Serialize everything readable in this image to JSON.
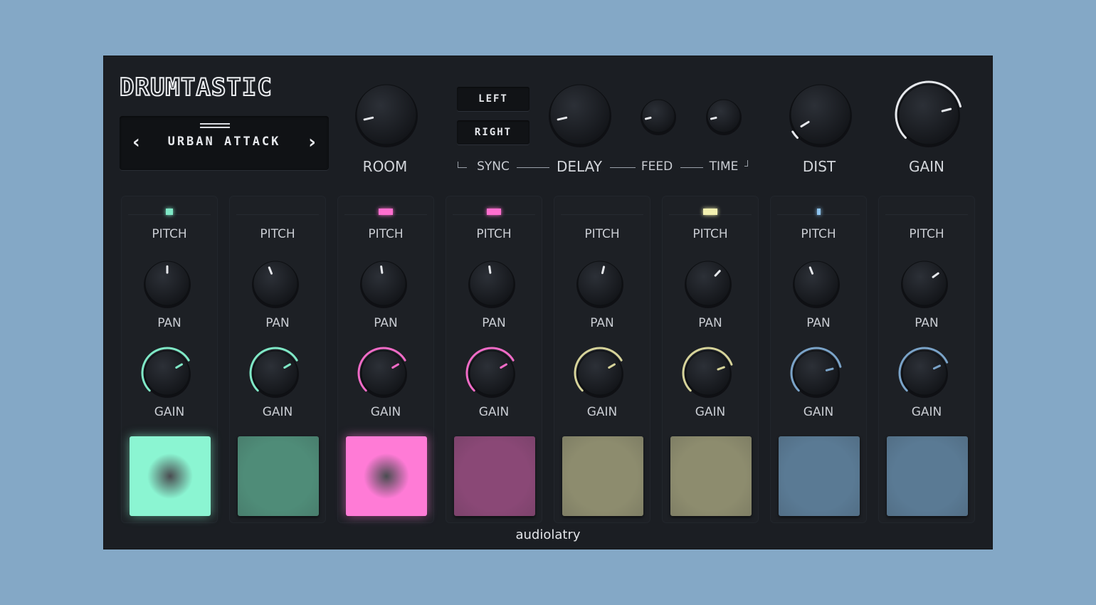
{
  "app": {
    "logo": "DRUMTASTIC",
    "brand": "audiolatry"
  },
  "preset": {
    "name": "URBAN ATTACK",
    "prev_icon": "‹",
    "next_icon": "›"
  },
  "top_knobs": {
    "room": {
      "label": "ROOM",
      "value": 0.12
    },
    "delay": {
      "label": "DELAY",
      "value": 0.12
    },
    "feed": {
      "label": "FEED",
      "value": 0.12
    },
    "time": {
      "label": "TIME",
      "value": 0.12
    },
    "dist": {
      "label": "DIST",
      "value": 0.05
    },
    "gain": {
      "label": "GAIN",
      "value": 0.78
    }
  },
  "stereo": {
    "left_label": "LEFT",
    "right_label": "RIGHT",
    "sync_label": "SYNC"
  },
  "colors": {
    "background": "#84a8c6",
    "panel": "#1b1e23",
    "teal": "#7fe8c6",
    "pink": "#f06bc6",
    "khaki": "#d6d39a",
    "blue": "#7aa3c8"
  },
  "channels": [
    {
      "pitch_label": "PITCH",
      "pan_label": "PAN",
      "gain_label": "GAIN",
      "color": "#7fe8c6",
      "pad_color": "#8bf5d2",
      "led_on": true,
      "led_color": "#7fe8c6",
      "pitch": 0.5,
      "pan": 0.5,
      "gain": 0.72,
      "pad_active": true
    },
    {
      "pitch_label": "PITCH",
      "pan_label": "PAN",
      "gain_label": "GAIN",
      "color": "#7fe8c6",
      "pad_color": "#4f8c78",
      "led_on": false,
      "led_color": "#7fe8c6",
      "pitch": 0.42,
      "pan": 0.5,
      "gain": 0.72,
      "pad_active": false
    },
    {
      "pitch_label": "PITCH",
      "pan_label": "PAN",
      "gain_label": "GAIN",
      "color": "#f06bc6",
      "pad_color": "#ff7bd6",
      "led_on": true,
      "led_color": "#ff6fcf",
      "pitch": 0.47,
      "pan": 0.5,
      "gain": 0.72,
      "pad_active": true
    },
    {
      "pitch_label": "PITCH",
      "pan_label": "PAN",
      "gain_label": "GAIN",
      "color": "#f06bc6",
      "pad_color": "#8a4876",
      "led_on": true,
      "led_color": "#ff6fcf",
      "pitch": 0.47,
      "pan": 0.5,
      "gain": 0.72,
      "pad_active": false
    },
    {
      "pitch_label": "PITCH",
      "pan_label": "PAN",
      "gain_label": "GAIN",
      "color": "#d6d39a",
      "pad_color": "#8d8c6e",
      "led_on": false,
      "led_color": "#f2f0b0",
      "pitch": 0.55,
      "pan": 0.5,
      "gain": 0.72,
      "pad_active": false
    },
    {
      "pitch_label": "PITCH",
      "pan_label": "PAN",
      "gain_label": "GAIN",
      "color": "#d6d39a",
      "pad_color": "#8d8c6e",
      "led_on": true,
      "led_color": "#f2f0b0",
      "pitch": 0.66,
      "pan": 0.5,
      "gain": 0.76,
      "pad_active": false
    },
    {
      "pitch_label": "PITCH",
      "pan_label": "PAN",
      "gain_label": "GAIN",
      "color": "#7aa3c8",
      "pad_color": "#5a7a94",
      "led_on": true,
      "led_color": "#8ec4ee",
      "pitch": 0.42,
      "pan": 0.5,
      "gain": 0.78,
      "pad_active": false
    },
    {
      "pitch_label": "PITCH",
      "pan_label": "PAN",
      "gain_label": "GAIN",
      "color": "#7aa3c8",
      "pad_color": "#5a7a94",
      "led_on": false,
      "led_color": "#8ec4ee",
      "pitch": 0.7,
      "pan": 0.5,
      "gain": 0.74,
      "pad_active": false
    }
  ]
}
